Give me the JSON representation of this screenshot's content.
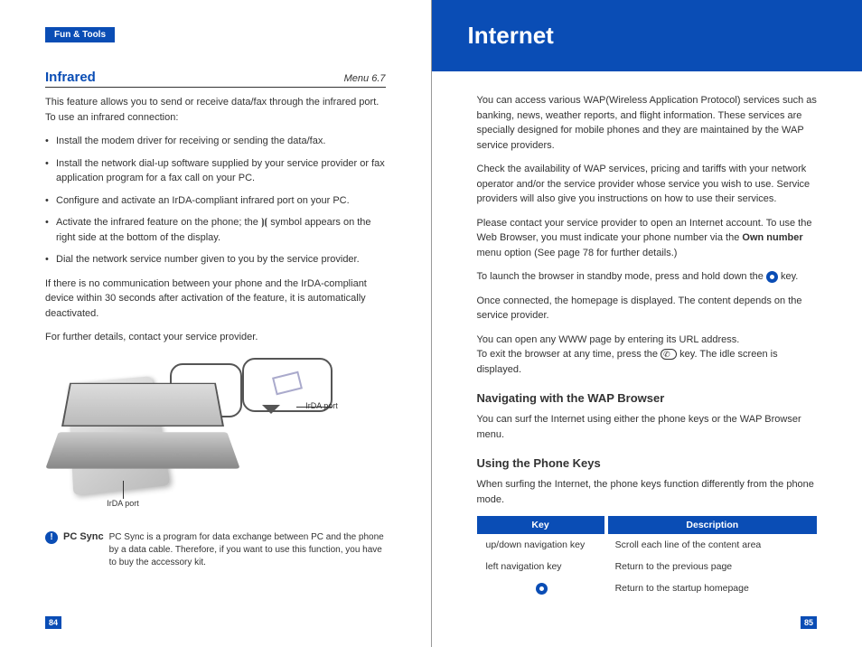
{
  "left": {
    "tab": "Fun & Tools",
    "section": "Infrared",
    "menu": "Menu 6.7",
    "intro": "This feature allows you to send or receive data/fax through the infrared port. To use an infrared connection:",
    "bullets": [
      "Install the modem driver for receiving or sending the data/fax.",
      "Install the network dial-up software supplied by your service provider or fax application program for a fax call on your PC.",
      "Configure and activate an IrDA-compliant infrared port on your PC.",
      "Activate the infrared feature on the phone; the ⦘⦗ symbol appears on the right side at the bottom of the display.",
      "Dial the network service number given to you by the service provider."
    ],
    "note1": "If there is no communication between your phone and the IrDA-compliant device within 30 seconds after activation of the feature, it is automatically deactivated.",
    "note2": "For further details, contact your service provider.",
    "fig": {
      "label1": "IrDA port",
      "label2": "IrDA port"
    },
    "pcsync": {
      "title": "PC Sync",
      "text": "PC Sync is a program for data exchange between PC and the phone by a data cable. Therefore, if you want to use this function, you have to buy the accessory kit."
    },
    "page": "84"
  },
  "right": {
    "chapter": "Internet",
    "p1": "You can access various WAP(Wireless Application Protocol) services such as banking, news, weather reports, and flight information. These services are specially designed for mobile phones and they are maintained by the WAP service providers.",
    "p2": "Check the availability of WAP services, pricing and tariffs with your network  operator and/or the service provider whose service you wish to use. Service providers will also give you instructions on how to use their services.",
    "p3a": "Please contact your service provider to open an Internet account. To use the Web Browser, you must indicate your phone number via the ",
    "p3b": "Own number",
    "p3c": " menu option (See page 78 for further details.)",
    "p4a": "To launch the browser in standby mode, press and hold down the ",
    "p4b": " key.",
    "p5": "Once connected, the homepage is displayed. The content depends on the service provider.",
    "p6a": "You can open any WWW page by entering its URL address.",
    "p6b": "To exit the browser at any time, press the ",
    "p6c": " key. The idle screen is displayed.",
    "h1": "Navigating with the WAP Browser",
    "p7": "You can surf the Internet using either the phone keys or the WAP Browser menu.",
    "h2": "Using the Phone Keys",
    "p8": "When surfing the Internet, the phone keys function differently from the phone mode.",
    "table": {
      "hkey": "Key",
      "hdesc": "Description",
      "rows": [
        {
          "k": "up/down navigation key",
          "d": "Scroll each line of the content area"
        },
        {
          "k": "left navigation key",
          "d": "Return to the previous page"
        },
        {
          "k": "",
          "d": "Return to the startup homepage"
        }
      ]
    },
    "page": "85"
  }
}
